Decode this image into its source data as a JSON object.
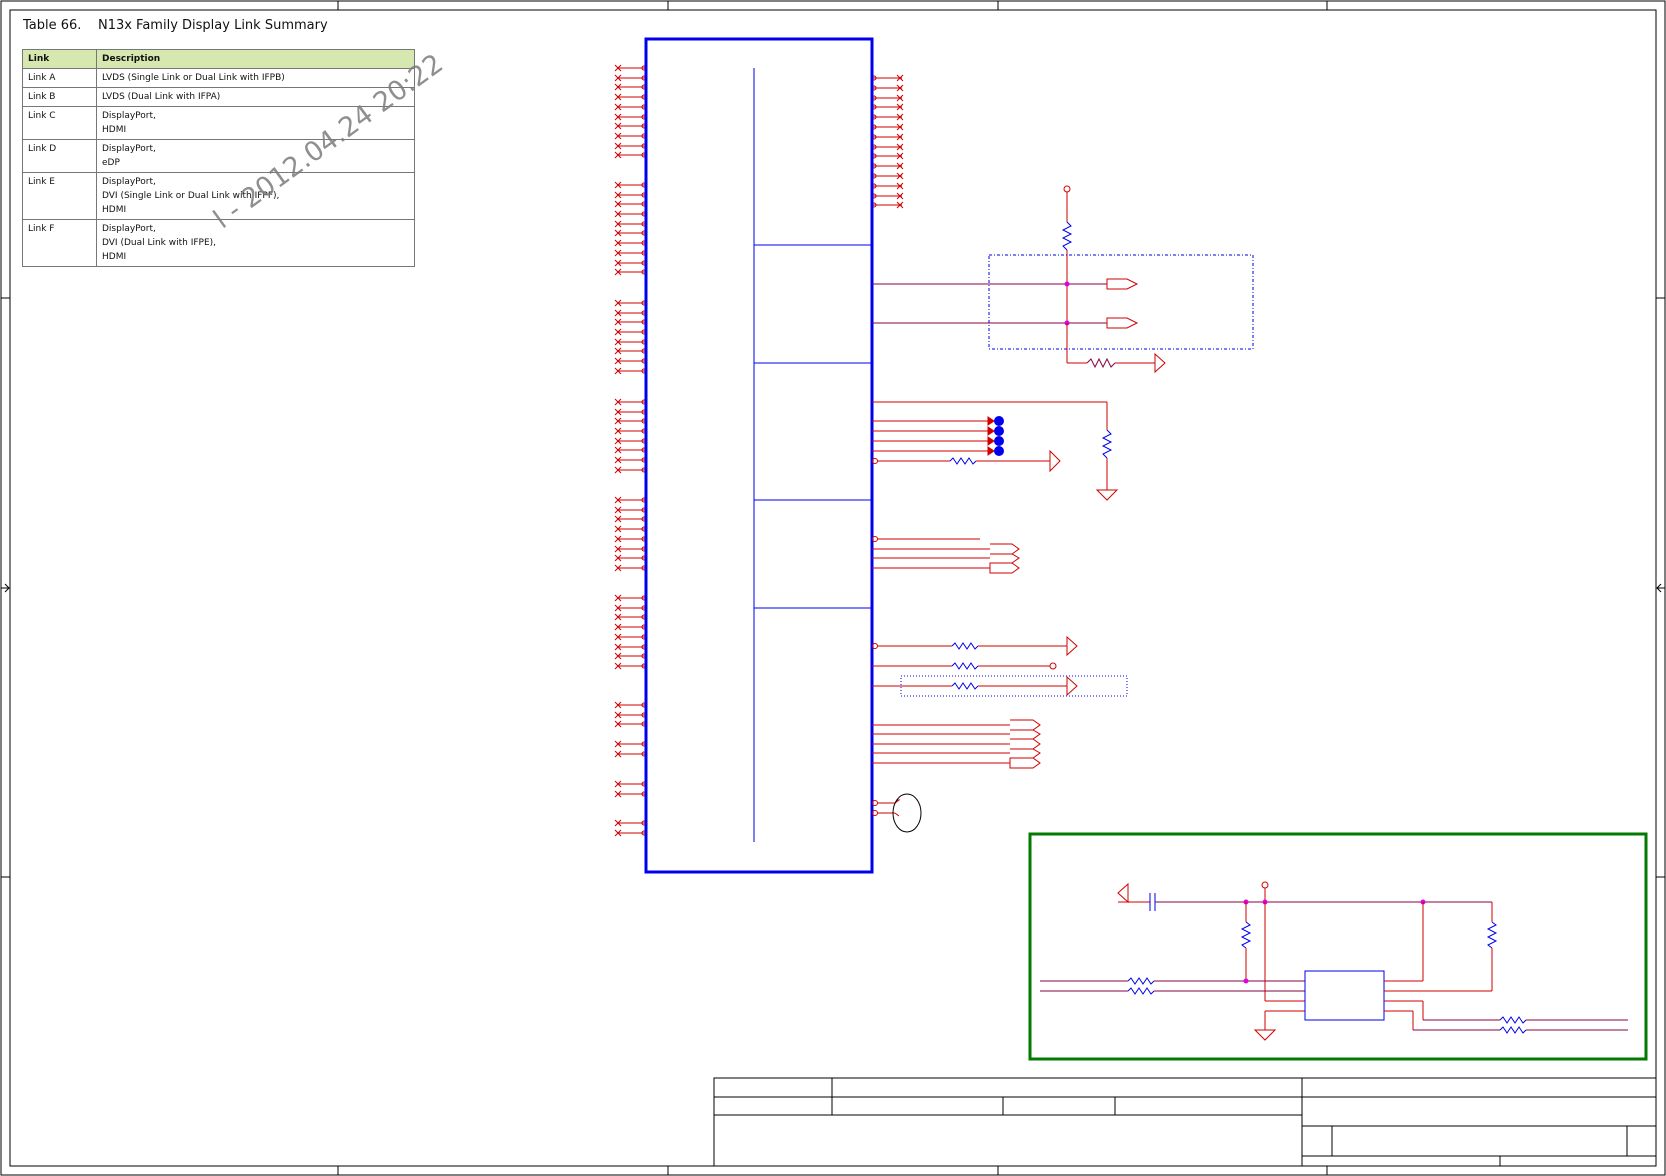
{
  "table": {
    "number": "Table 66.",
    "title": "N13x Family Display Link Summary",
    "headers": [
      "Link",
      "Description"
    ],
    "rows": [
      {
        "link": "Link A",
        "desc": [
          "LVDS (Single Link or Dual Link with IFPB)"
        ]
      },
      {
        "link": "Link B",
        "desc": [
          "LVDS (Dual Link with IFPA)"
        ]
      },
      {
        "link": "Link C",
        "desc": [
          "DisplayPort,",
          "HDMI"
        ]
      },
      {
        "link": "Link D",
        "desc": [
          "DisplayPort,",
          "eDP"
        ]
      },
      {
        "link": "Link E",
        "desc": [
          "DisplayPort,",
          "DVI (Single Link or Dual Link with IFPF),",
          "HDMI"
        ]
      },
      {
        "link": "Link F",
        "desc": [
          "DisplayPort,",
          "DVI (Dual Link with IFPE),",
          "HDMI"
        ]
      }
    ]
  },
  "watermark": "l - 2012.04.24 20:22",
  "colors": {
    "wire": "#d10000",
    "wire_dark": "#8a0040",
    "part": "#0000ee",
    "junction": "#e000e0",
    "frame": "#000000",
    "highlight_box": "#007a00",
    "table_header": "#d6e8b0"
  }
}
